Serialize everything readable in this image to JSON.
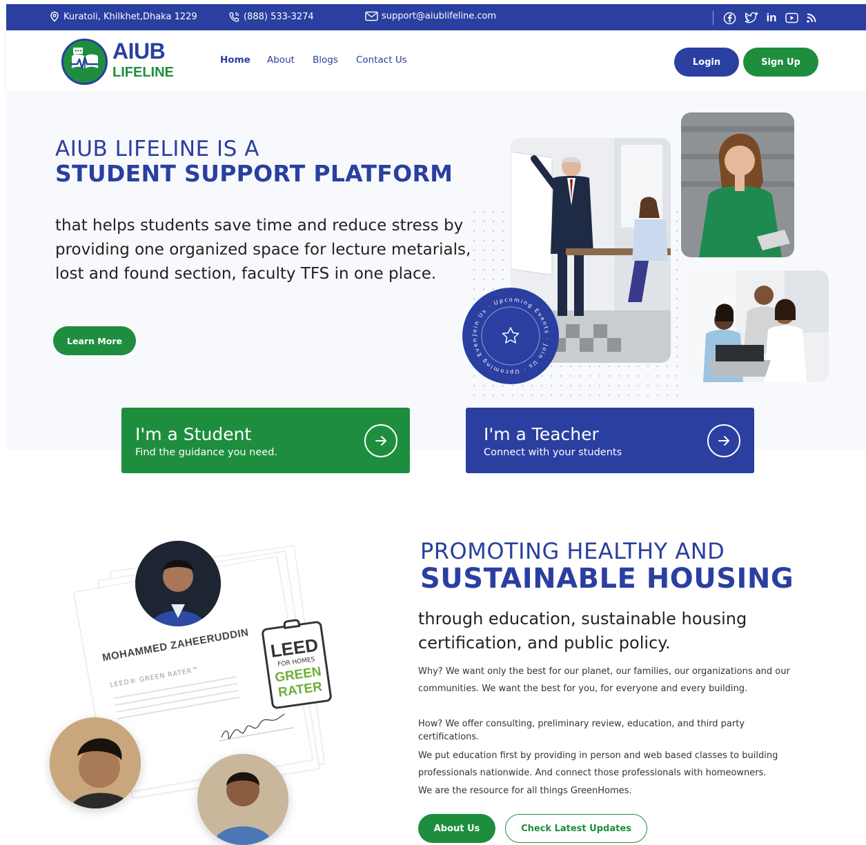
{
  "topbar": {
    "address": "Kuratoli, Khilkhet,Dhaka 1229",
    "phone": "(888) 533-3274",
    "email": "support@aiublifeline.com",
    "social_icons": [
      "facebook-icon",
      "twitter-icon",
      "linkedin-icon",
      "youtube-icon",
      "rss-icon"
    ]
  },
  "brand": {
    "name_top": "AIUB",
    "name_bottom": "LIFELINE"
  },
  "nav": {
    "links": [
      {
        "label": "Home",
        "active": true
      },
      {
        "label": "About"
      },
      {
        "label": "Blogs"
      },
      {
        "label": "Contact Us"
      }
    ],
    "login": "Login",
    "signup": "Sign Up"
  },
  "hero": {
    "title_line1": "AIUB LIFELINE IS A",
    "title_line2": "STUDENT SUPPORT PLATFORM",
    "description": "that helps students save time and reduce stress by providing one organized space for lecture metarials, lost and found section, faculty TFS in one place.",
    "cta": "Learn More",
    "badge_text": "Join Us · Upcoming Events · Join Us · Upcoming Events ·"
  },
  "roles": {
    "student": {
      "title": "I'm a Student",
      "subtitle": "Find the guidance you need."
    },
    "teacher": {
      "title": "I'm a Teacher",
      "subtitle": "Connect with your students"
    }
  },
  "section2": {
    "title_line1": "PROMOTING HEALTHY AND",
    "title_line2": "SUSTAINABLE HOUSING",
    "subtitle": "through education, sustainable housing certification, and public policy.",
    "para1": "Why? We want only the best for our planet, our families, our organizations and our communities. We want the best for you, for everyone and every building.",
    "para2": "How? We offer consulting, preliminary review, education, and third party certifications.",
    "para3": "We put education first by providing in person and web based classes to building professionals nationwide. And connect those professionals with homeowners.",
    "para4": "We are the resource for all things GreenHomes.",
    "about_btn": "About Us",
    "updates_btn": "Check Latest Updates"
  },
  "certificate": {
    "name": "MOHAMMED ZAHEERUDDIN",
    "program": "LEED® GREEN RATER™",
    "leed_title": "LEED",
    "leed_for": "FOR HOMES",
    "leed_green": "GREEN",
    "leed_rater": "RATER"
  },
  "colors": {
    "primary_blue": "#2a3fa0",
    "primary_green": "#1e8e3e"
  }
}
